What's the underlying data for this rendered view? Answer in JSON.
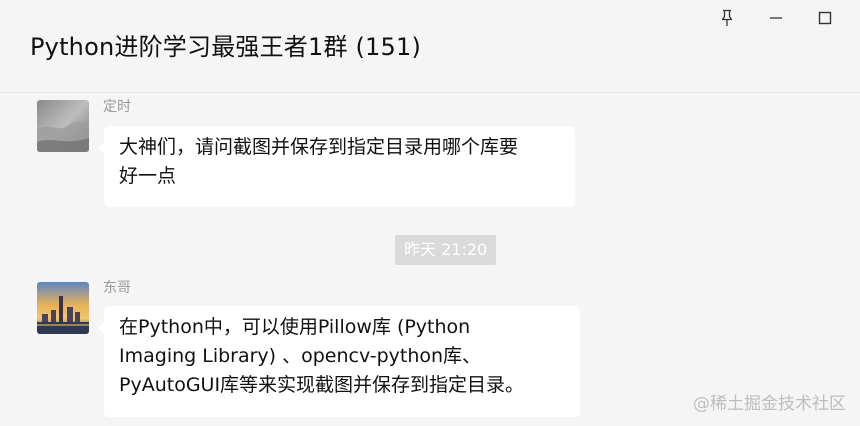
{
  "window": {
    "title": "Python进阶学习最强王者1群 (151)",
    "controls": {
      "pin_icon": "pin-icon",
      "minimize_icon": "minimize-icon",
      "maximize_icon": "maximize-icon"
    }
  },
  "messages": [
    {
      "sender": "定时",
      "avatar": "gray-photo-avatar",
      "lines": [
        "大神们，请问截图并保存到指定目录用哪个库要",
        "好一点"
      ]
    },
    {
      "sender": "东哥",
      "avatar": "city-sunset-avatar",
      "lines": [
        "在Python中，可以使用Pillow库 (Python",
        "Imaging Library) 、opencv-python库、",
        "PyAutoGUI库等来实现截图并保存到指定目录。"
      ]
    }
  ],
  "time_separator": "昨天 21:20",
  "watermark": "@稀土掘金技术社区",
  "colors": {
    "background": "#f5f5f5",
    "bubble": "#ffffff",
    "time_badge": "#dadada",
    "sender_text": "#9a9a9a"
  }
}
